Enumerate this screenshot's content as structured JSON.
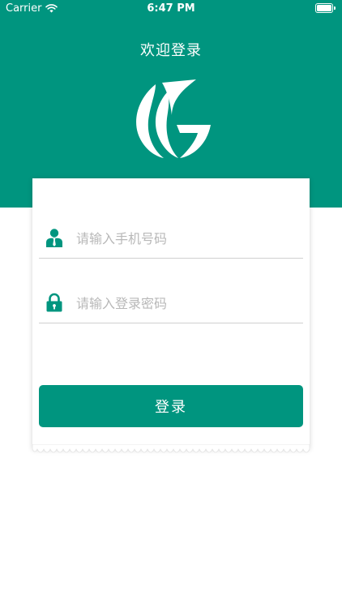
{
  "status_bar": {
    "carrier": "Carrier",
    "time": "6:47 PM",
    "battery_level": 1.0
  },
  "header": {
    "title": "欢迎登录"
  },
  "form": {
    "phone_placeholder": "请输入手机号码",
    "password_placeholder": "请输入登录密码",
    "login_label": "登录"
  },
  "colors": {
    "brand": "#00957F",
    "icon": "#00957F",
    "divider": "#CFCFCF",
    "placeholder": "#B8B8B8"
  },
  "icons": {
    "status": [
      "wifi-icon",
      "battery-icon"
    ],
    "phone_field": "user-icon",
    "password_field": "lock-icon",
    "logo": "leaf-logo"
  }
}
